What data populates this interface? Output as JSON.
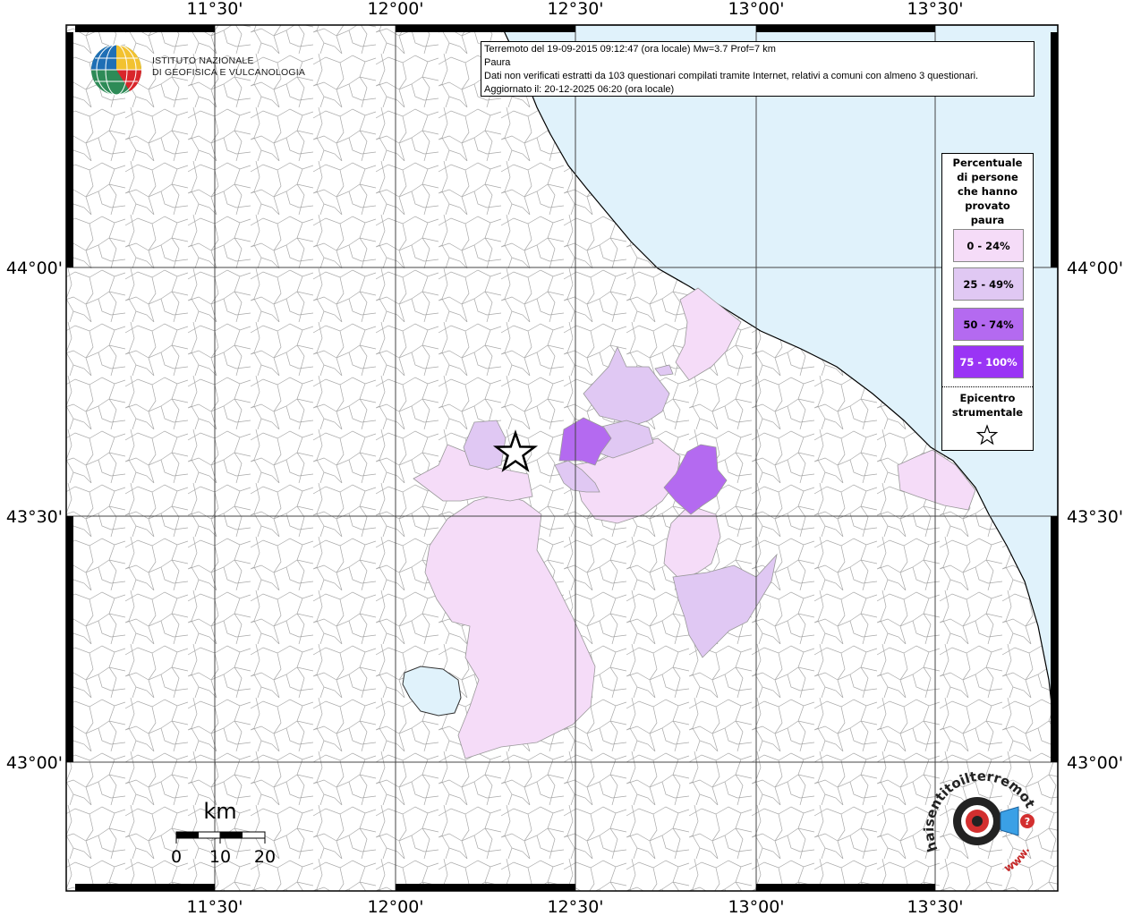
{
  "event_info": {
    "line1": "Terremoto del 19-09-2015 09:12:47 (ora locale) Mw=3.7 Prof=7 km",
    "line2": "Paura",
    "line3": "Dati non verificati estratti da 103 questionari compilati tramite Internet, relativi a comuni con almeno 3 questionari.",
    "line4": "Aggiornato il: 20-12-2025 06:20 (ora locale)"
  },
  "logo_ingv": {
    "line1": "ISTITUTO NAZIONALE",
    "line2": "DI GEOFISICA E VULCANOLOGIA"
  },
  "logo_hst": {
    "text": "haisentitoilterremoto.it",
    "www": "www."
  },
  "axes": {
    "lon_labels": [
      "11°30'",
      "12°00'",
      "12°30'",
      "13°00'",
      "13°30'"
    ],
    "lat_labels": [
      "44°00'",
      "43°30'",
      "43°00'"
    ]
  },
  "legend": {
    "title": "Percentuale\ndi persone\nche hanno\nprovato\npaura",
    "classes": [
      {
        "label": "0 - 24%",
        "color": "#f5dcf8",
        "text_color": "#000000"
      },
      {
        "label": "25 - 49%",
        "color": "#e0c8f3",
        "text_color": "#000000"
      },
      {
        "label": "50 - 74%",
        "color": "#b46af0",
        "text_color": "#000000"
      },
      {
        "label": "75 - 100%",
        "color": "#9a34f5",
        "text_color": "#ffffff"
      }
    ],
    "epicenter_label": "Epicentro\nstrumentale"
  },
  "scale_bar": {
    "unit": "km",
    "ticks": [
      "0",
      "10",
      "20"
    ]
  },
  "colors": {
    "sea": "#e0f2fb",
    "lake": "#e0f2fb",
    "boundary": "#9a9a9a",
    "grid": "#444444"
  }
}
